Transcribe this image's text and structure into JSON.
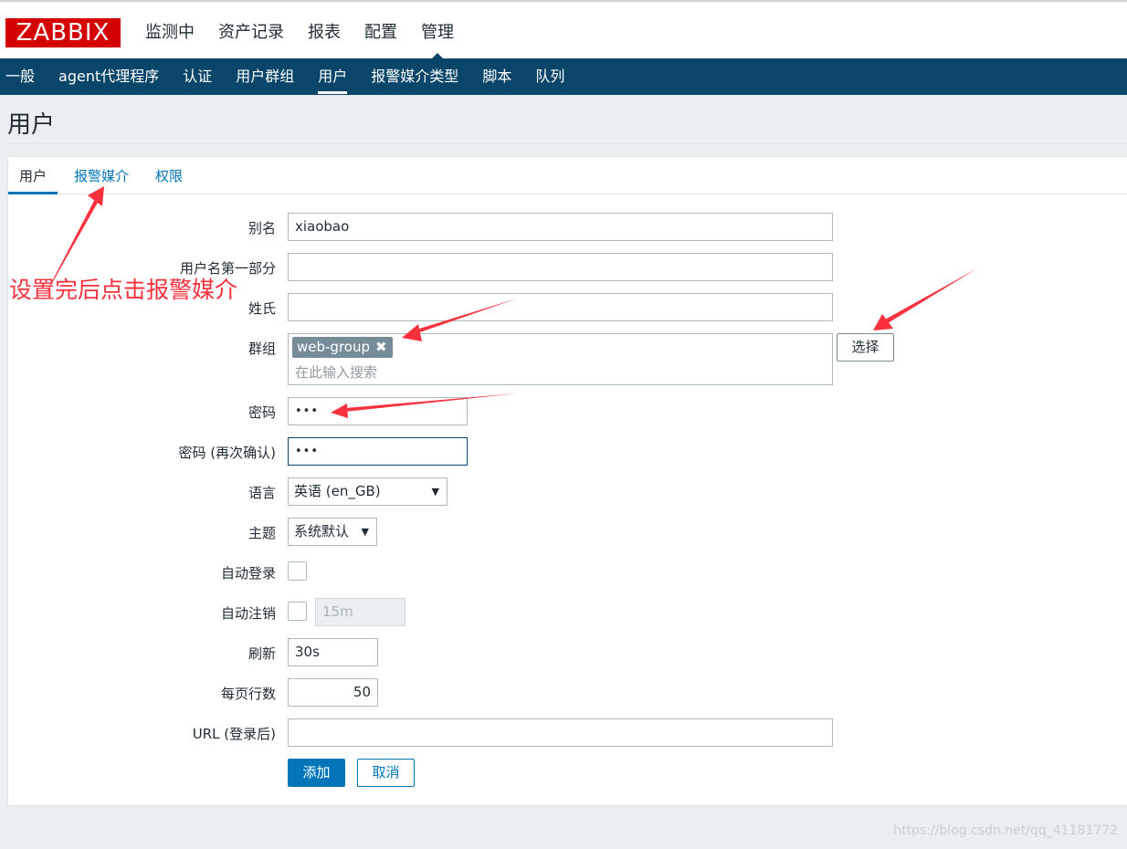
{
  "header": {
    "logo": "ZABBIX",
    "menu": [
      "监测中",
      "资产记录",
      "报表",
      "配置",
      "管理"
    ]
  },
  "subnav": [
    "一般",
    "agent代理程序",
    "认证",
    "用户群组",
    "用户",
    "报警媒介类型",
    "脚本",
    "队列"
  ],
  "page_title": "用户",
  "tabs": [
    "用户",
    "报警媒介",
    "权限"
  ],
  "form": {
    "alias_label": "别名",
    "alias_value": "xiaobao",
    "name_label": "用户名第一部分",
    "surname_label": "姓氏",
    "groups_label": "群组",
    "group_chip": "web-group",
    "group_chip_remove": "✖",
    "groups_placeholder": "在此输入搜索",
    "select_button": "选择",
    "password_label": "密码",
    "password_value": "•••",
    "password_confirm_label": "密码 (再次确认)",
    "password_confirm_value": "•••",
    "language_label": "语言",
    "language_value": "英语 (en_GB)",
    "theme_label": "主题",
    "theme_value": "系统默认",
    "autologin_label": "自动登录",
    "autologout_label": "自动注销",
    "autologout_value": "15m",
    "refresh_label": "刷新",
    "refresh_value": "30s",
    "rows_label": "每页行数",
    "rows_value": "50",
    "url_label": "URL (登录后)",
    "add_button": "添加",
    "cancel_button": "取消"
  },
  "annotation": "设置完后点击报警媒介",
  "watermark": "https://blog.csdn.net/qq_41181772",
  "colors": {
    "brand": "#d40000",
    "nav": "#0a466a",
    "primary": "#0275b8",
    "annotation": "#f8313d"
  }
}
